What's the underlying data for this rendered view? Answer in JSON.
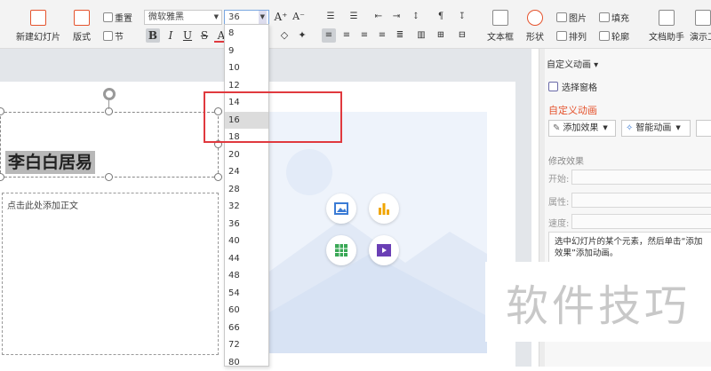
{
  "ribbon": {
    "new_slide": "新建幻灯片",
    "layout": "版式",
    "reset": "重置",
    "section": "节",
    "font_name": "微软雅黑",
    "font_size": "36",
    "bold": "B",
    "italic": "I",
    "underline": "U",
    "strike": "S",
    "font_color": "A",
    "textbox": "文本框",
    "shape": "形状",
    "picture": "图片",
    "fill": "填充",
    "arrange": "排列",
    "outline": "轮廓",
    "doc_helper": "文档助手",
    "presentation_tool": "演示工"
  },
  "font_size_dropdown": {
    "options": [
      "8",
      "9",
      "10",
      "12",
      "14",
      "16",
      "18",
      "20",
      "24",
      "28",
      "32",
      "36",
      "40",
      "44",
      "48",
      "54",
      "60",
      "66",
      "72",
      "80"
    ],
    "selected": "16"
  },
  "slide": {
    "title_text": "李白白居易",
    "body_placeholder": "点击此处添加正文"
  },
  "panel": {
    "header": "自定义动画",
    "selection_pane": "选择窗格",
    "section_title": "自定义动画",
    "add_effect": "添加效果",
    "smart_animation": "智能动画",
    "modify_effect": "修改效果",
    "start_label": "开始:",
    "property_label": "属性:",
    "speed_label": "速度:",
    "hint": "选中幻灯片的某个元素，然后单击“添加效果”添加动画。"
  },
  "watermark": "软件技巧",
  "colors": {
    "accent_orange": "#e5532d",
    "highlight_red": "#e0393e",
    "chart_gold": "#f0a500",
    "table_green": "#3aa856",
    "video_purple": "#6a3fb5",
    "image_blue": "#3a7bd5"
  }
}
